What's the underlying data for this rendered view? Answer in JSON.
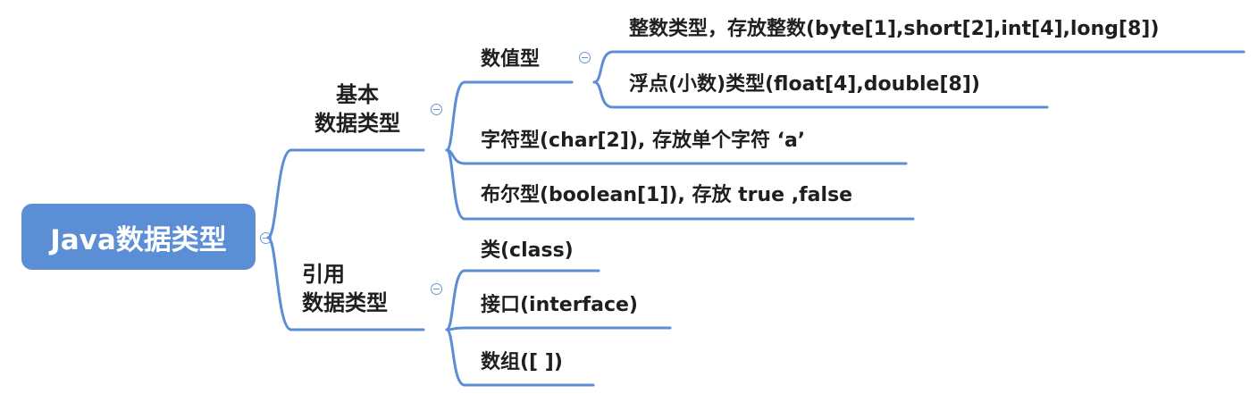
{
  "root": {
    "label": "Java数据类型"
  },
  "colors": {
    "root_fill": "#5b8ed4",
    "line": "#5b8ed4",
    "text": "#1f1f1f"
  },
  "branches": [
    {
      "label_line1": "基本",
      "label_line2": "数据类型",
      "children": [
        {
          "label": "数值型",
          "children": [
            {
              "label": "整数类型，存放整数(byte[1],short[2],int[4],long[8])"
            },
            {
              "label": "浮点(小数)类型(float[4],double[8])"
            }
          ]
        },
        {
          "label": "字符型(char[2]), 存放单个字符 ‘a’"
        },
        {
          "label": "布尔型(boolean[1]), 存放 true ,false"
        }
      ]
    },
    {
      "label_line1": "引用",
      "label_line2": "数据类型",
      "children": [
        {
          "label": "类(class)"
        },
        {
          "label": "接口(interface)"
        },
        {
          "label": "数组([ ])"
        }
      ]
    }
  ]
}
